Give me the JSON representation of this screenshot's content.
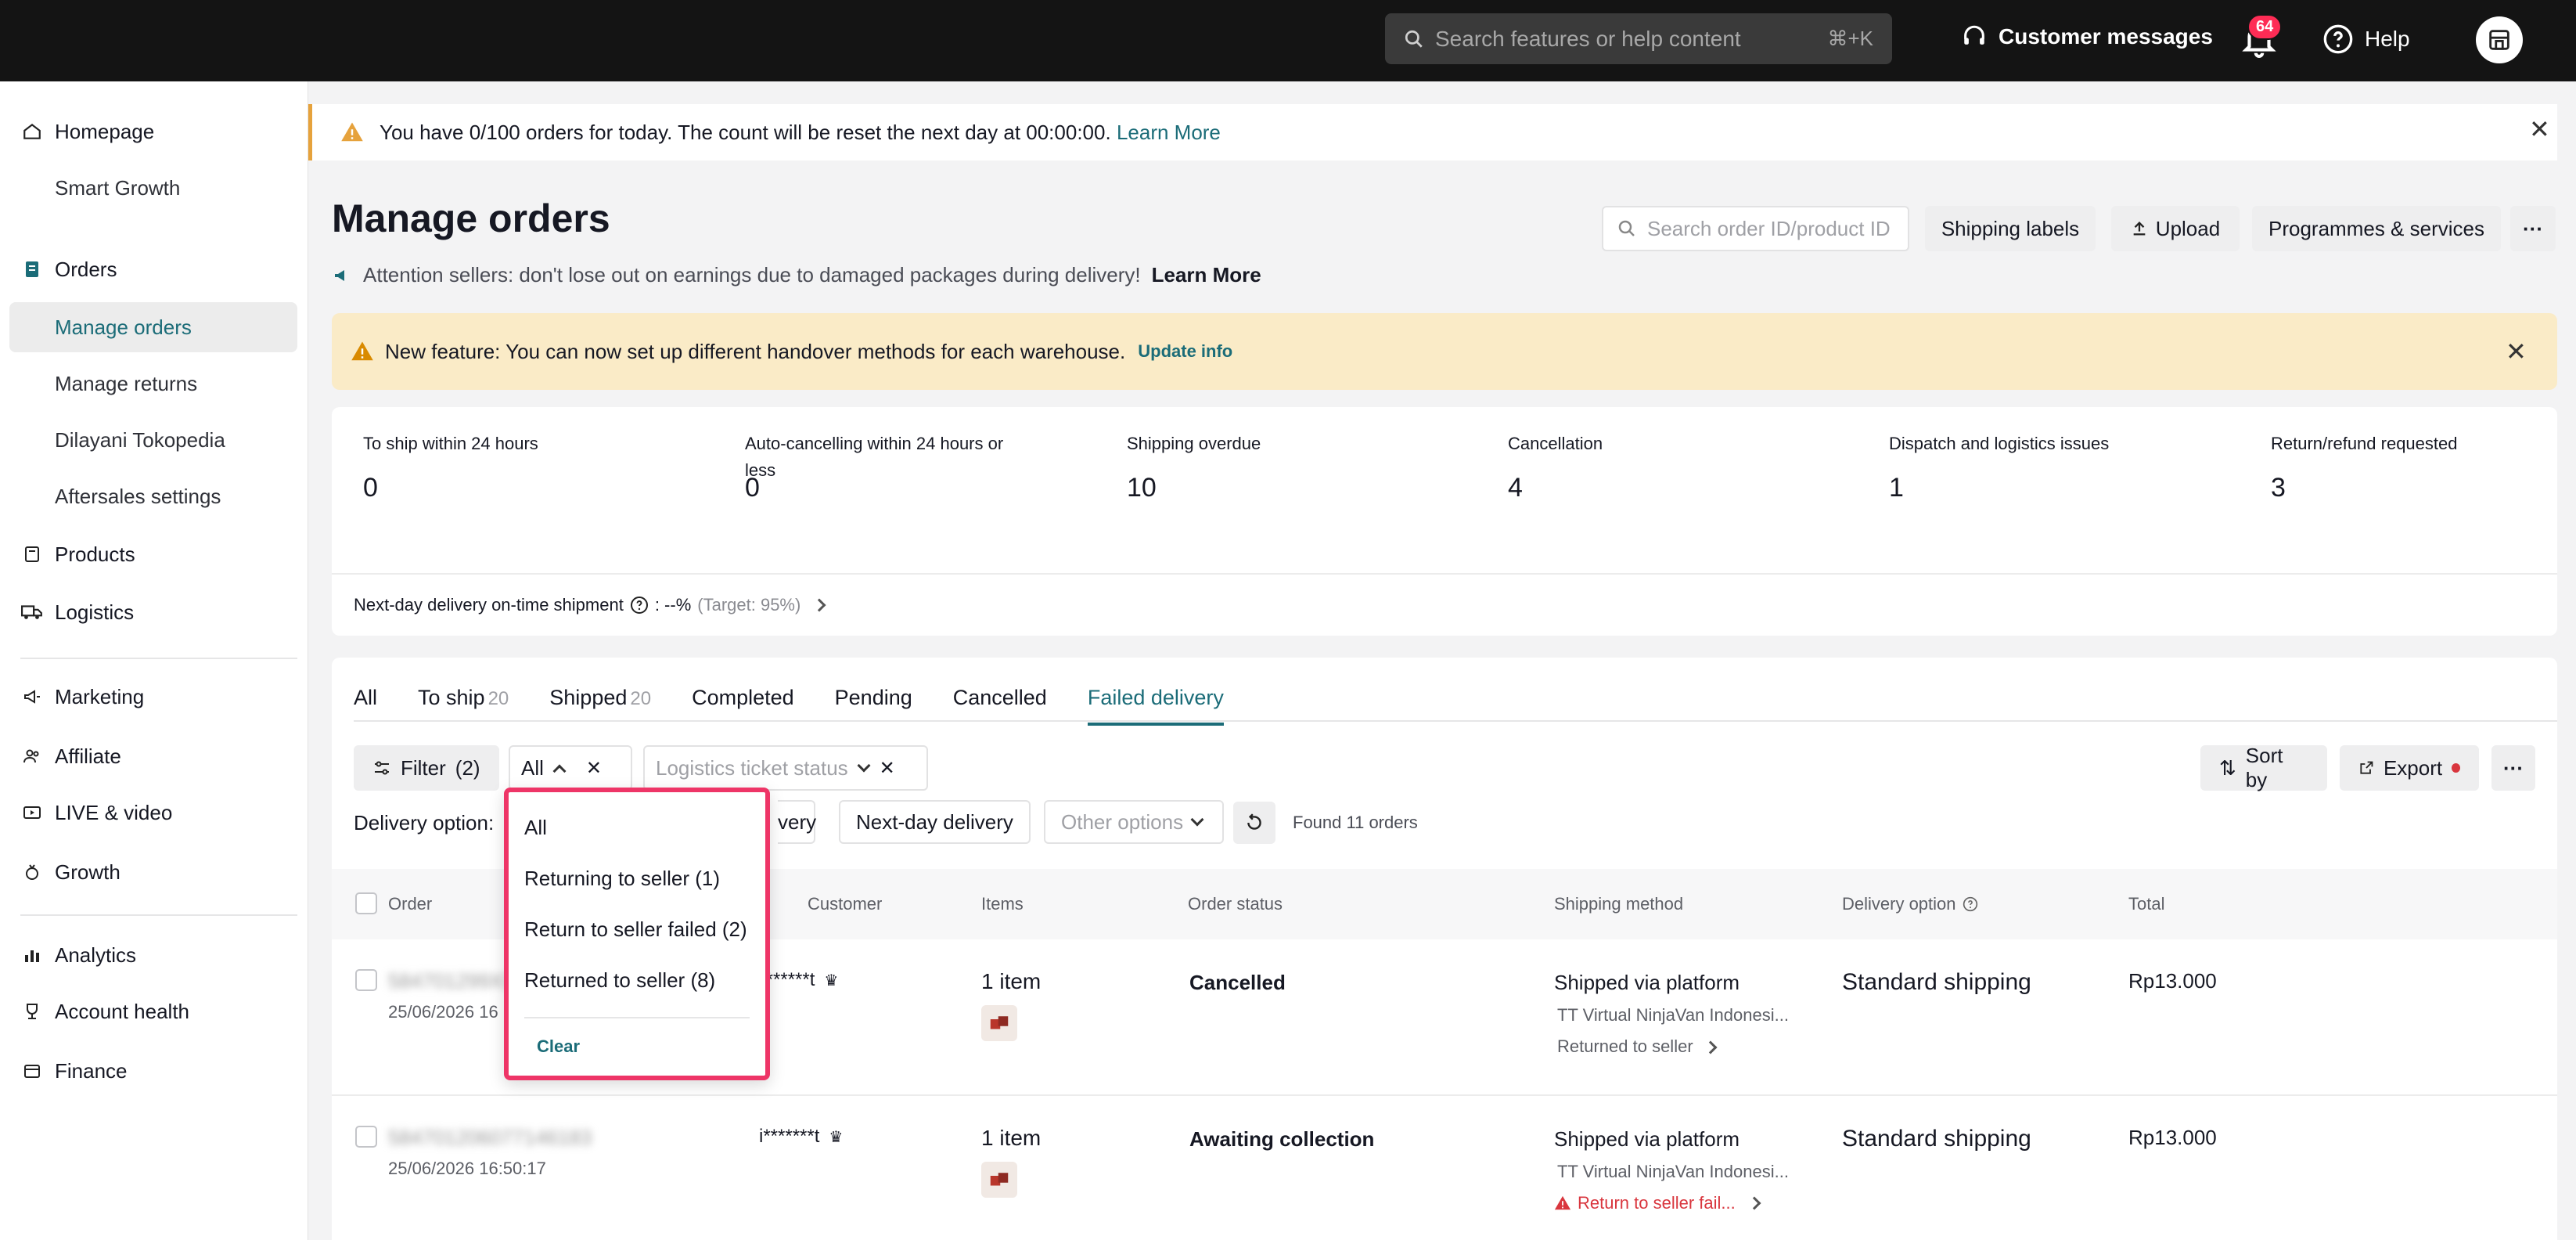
{
  "topbar": {
    "search_placeholder": "Search features or help content",
    "search_shortcut": "⌘+K",
    "customer_messages": "Customer messages",
    "notification_count": "64",
    "help": "Help"
  },
  "sidebar": {
    "homepage": "Homepage",
    "smart_growth": "Smart Growth",
    "orders": "Orders",
    "manage_orders": "Manage orders",
    "manage_returns": "Manage returns",
    "dilayani": "Dilayani Tokopedia",
    "aftersales": "Aftersales settings",
    "products": "Products",
    "logistics": "Logistics",
    "marketing": "Marketing",
    "affiliate": "Affiliate",
    "live_video": "LIVE & video",
    "growth": "Growth",
    "analytics": "Analytics",
    "account_health": "Account health",
    "finance": "Finance"
  },
  "alert_top": {
    "text": "You have 0/100 orders for today. The count will be reset the next day at 00:00:00.",
    "link": "Learn More"
  },
  "header": {
    "title": "Manage orders",
    "attention": "Attention sellers: don't lose out on earnings due to damaged packages during delivery!",
    "attention_link": "Learn More",
    "search_placeholder": "Search order ID/product ID",
    "shipping_labels": "Shipping labels",
    "upload": "Upload",
    "programmes": "Programmes & services"
  },
  "feature_alert": {
    "text": "New feature: You can now set up different handover methods for each warehouse.",
    "link": "Update info"
  },
  "stats": [
    {
      "label": "To ship within 24 hours",
      "value": "0"
    },
    {
      "label": "Auto-cancelling within 24 hours or less",
      "value": "0"
    },
    {
      "label": "Shipping overdue",
      "value": "10"
    },
    {
      "label": "Cancellation",
      "value": "4"
    },
    {
      "label": "Dispatch and logistics issues",
      "value": "1"
    },
    {
      "label": "Return/refund requested",
      "value": "3"
    }
  ],
  "ontime": {
    "label": "Next-day delivery on-time shipment",
    "value": ": --%",
    "target": "(Target: 95%)"
  },
  "tabs": [
    {
      "label": "All",
      "count": ""
    },
    {
      "label": "To ship",
      "count": "20"
    },
    {
      "label": "Shipped",
      "count": "20"
    },
    {
      "label": "Completed",
      "count": ""
    },
    {
      "label": "Pending",
      "count": ""
    },
    {
      "label": "Cancelled",
      "count": ""
    },
    {
      "label": "Failed delivery",
      "count": ""
    }
  ],
  "filters": {
    "filter_btn": "Filter",
    "filter_count": "(2)",
    "status_value": "All",
    "logistics_placeholder": "Logistics ticket status",
    "sort_by": "Sort by",
    "export": "Export",
    "delivery_label": "Delivery option:",
    "chip_partial": "very",
    "next_day": "Next-day delivery",
    "other_options": "Other options",
    "found": "Found 11 orders"
  },
  "table": {
    "headers": [
      "Order",
      "Customer",
      "Items",
      "Order status",
      "Shipping method",
      "Delivery option",
      "Total"
    ],
    "rows": [
      {
        "order_id": "584701299XXXXXXXX",
        "date": "25/06/2026 16",
        "customer": "i*******t",
        "items": "1 item",
        "status": "Cancelled",
        "ship_method": "Shipped via platform",
        "carrier": "TT Virtual NinjaVan Indonesi...",
        "ship_status": "Returned to seller",
        "delivery": "Standard shipping",
        "total": "Rp13.000"
      },
      {
        "order_id": "584701206077146183",
        "date": "25/06/2026 16:50:17",
        "customer": "i*******t",
        "items": "1 item",
        "status": "Awaiting collection",
        "ship_method": "Shipped via platform",
        "carrier": "TT Virtual NinjaVan Indonesi...",
        "ship_status": "Return to seller fail...",
        "delivery": "Standard shipping",
        "total": "Rp13.000"
      }
    ]
  },
  "dropdown": {
    "options": [
      "All",
      "Returning to seller (1)",
      "Return to seller failed (2)",
      "Returned to seller (8)"
    ],
    "clear": "Clear"
  },
  "colors": {
    "accent": "#1b6c78",
    "highlight": "#ee3567",
    "warning": "#e6a23c",
    "error": "#d9363e"
  }
}
